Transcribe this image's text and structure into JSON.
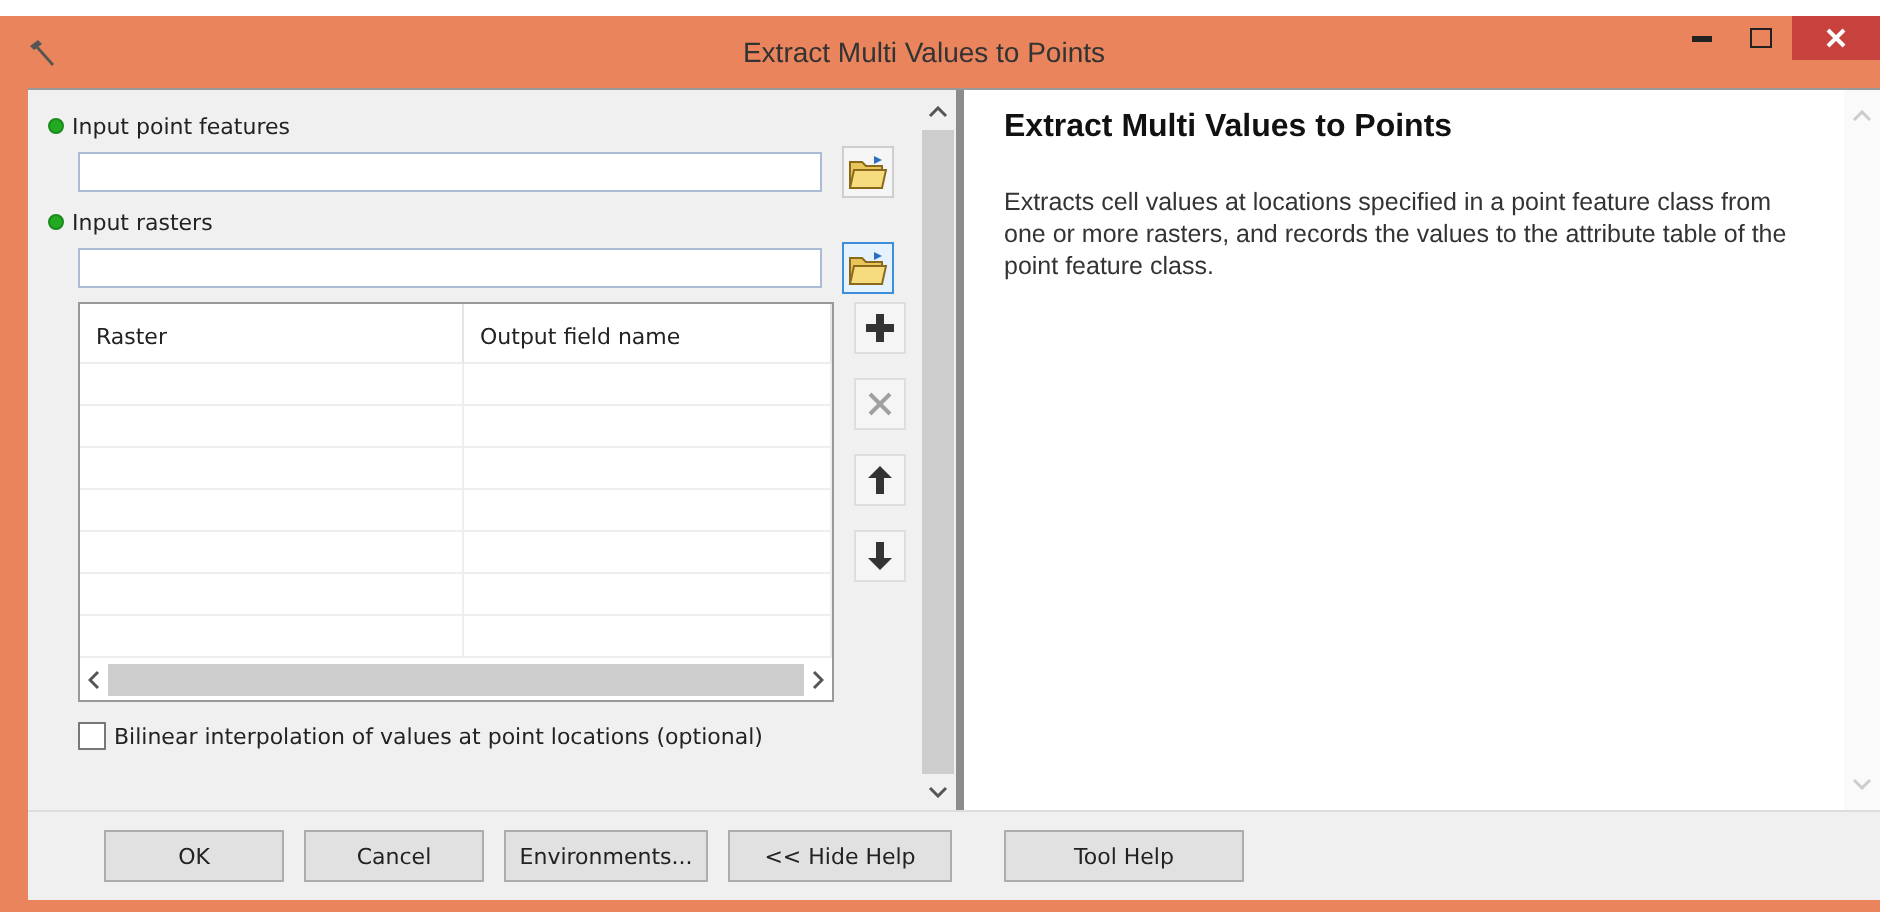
{
  "window": {
    "title": "Extract Multi Values to Points"
  },
  "parameters": [
    {
      "label": "Input point features",
      "required": true,
      "focused": false
    },
    {
      "label": "Input rasters",
      "required": true,
      "focused": true
    }
  ],
  "table": {
    "columns": [
      "Raster",
      "Output field name"
    ]
  },
  "table_tools": [
    {
      "kind": "add",
      "disabled": false
    },
    {
      "kind": "remove",
      "disabled": true
    },
    {
      "kind": "up",
      "disabled": false
    },
    {
      "kind": "down",
      "disabled": false
    }
  ],
  "option": {
    "label": "Bilinear interpolation of values at point locations (optional)",
    "checked": false
  },
  "help": {
    "title": "Extract Multi Values to Points",
    "text": "Extracts cell values at locations specified in a point feature class from one or more rasters, and records the values to the attribute table of the point feature class."
  },
  "buttons": [
    {
      "label": "OK"
    },
    {
      "label": "Cancel"
    },
    {
      "label": "Environments..."
    },
    {
      "label": "<< Hide Help"
    }
  ],
  "help_button": {
    "label": "Tool Help"
  }
}
